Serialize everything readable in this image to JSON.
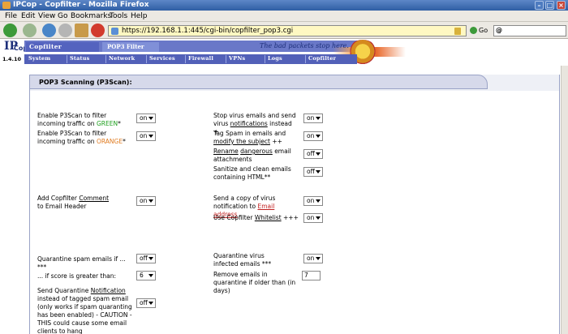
{
  "window": {
    "title": "IPCop - Copfilter - Mozilla Firefox"
  },
  "menu": [
    "File",
    "Edit",
    "View",
    "Go",
    "Bookmarks",
    "Tools",
    "Help"
  ],
  "address": {
    "url": "https://192.168.1.1:445/cgi-bin/copfilter_pop3.cgi",
    "go_label": "Go"
  },
  "brand": {
    "logo_line1": "IP",
    "logo_line2": "Cop",
    "version": "1.4.10",
    "app_tab": "Copfilter",
    "sub_tab": "POP3 Filter",
    "slogan": "The bad packets stop here."
  },
  "topnav": [
    "System",
    "Status",
    "Network",
    "Services",
    "Firewall",
    "VPNs",
    "Logs",
    "Copfilter"
  ],
  "panel": {
    "title": "POP3 Scanning (P3Scan):"
  },
  "left": {
    "enable_green_pre": "Enable P3Scan to filter incoming traffic on ",
    "enable_green_zone": "GREEN",
    "enable_green_post": "*",
    "enable_green_value": "on",
    "enable_orange_pre": "Enable P3Scan to filter incoming traffic on ",
    "enable_orange_zone": "ORANGE",
    "enable_orange_post": "*",
    "enable_orange_value": "on",
    "comment_pre": "Add Copfilter ",
    "comment_link": "Comment",
    "comment_post": "to Email Header",
    "comment_value": "on",
    "quarantine_spam": "Quarantine spam emails if ... ***",
    "quarantine_spam_value": "off",
    "score_label": "... if score is greater than:",
    "score_value": "6",
    "notify_pre": "Send Quarantine ",
    "notify_link": "Notification",
    "notify_post": " instead of tagged spam email (only works if spam quaranting has been enabled) - CAUTION - THIS could cause some email clients to hang",
    "notify_value": "off"
  },
  "right": {
    "stop_virus_pre": "Stop virus emails and send virus ",
    "stop_virus_link": "notifications",
    "stop_virus_post": " instead +",
    "stop_virus_value": "on",
    "tag_spam_pre": "Tag Spam in emails and ",
    "tag_spam_link": "modify the subject",
    "tag_spam_post": " ++",
    "tag_spam_value": "on",
    "rename_link1": "Rename",
    "rename_mid": " ",
    "rename_link2": "dangerous",
    "rename_post": " email attachments",
    "rename_value": "off",
    "sanitize": "Sanitize and clean emails containing HTML**",
    "sanitize_value": "off",
    "copy_virus_pre": "Send a copy of virus notification to ",
    "copy_virus_link": "Email address",
    "copy_virus_value": "on",
    "whitelist_pre": "Use Copfilter ",
    "whitelist_link": "Whitelist",
    "whitelist_post": " +++",
    "whitelist_value": "on",
    "quarantine_virus": "Quarantine virus infected emails ***",
    "quarantine_virus_value": "on",
    "remove_days": "Remove emails in quarantine if older than (in days)",
    "remove_days_value": "7"
  }
}
